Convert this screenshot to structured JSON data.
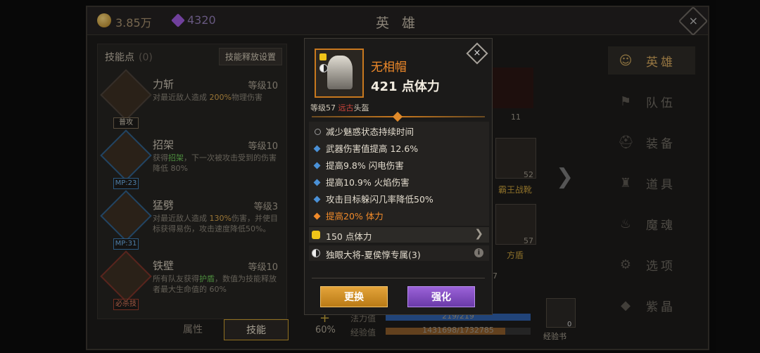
{
  "topbar": {
    "gold": "3.85万",
    "gems": "4320",
    "title": "英 雄",
    "close_label": "×"
  },
  "skills_panel": {
    "header": "技能点",
    "count": "(0)",
    "release_settings": "技能释放设置",
    "skills": [
      {
        "name": "力斩",
        "level": "等级10",
        "tag": "普攻",
        "desc_a": "对最近敌人造成 ",
        "desc_hl": "200%",
        "desc_b": "物理伤害"
      },
      {
        "name": "招架",
        "level": "等级10",
        "tag": "MP:23",
        "desc_a": "获得",
        "desc_hl": "招架",
        "desc_b": "，下一次被攻击受到的伤害降低 80%"
      },
      {
        "name": "猛劈",
        "level": "等级3",
        "tag": "MP:31",
        "desc_a": "对最近敌人造成 ",
        "desc_hl": "130%",
        "desc_b": "伤害，并使目标获得易伤，攻击速度降低50%。"
      },
      {
        "name": "铁壁",
        "level": "等级10",
        "tag": "必杀技",
        "desc_a": "所有队友获得",
        "desc_hl": "护盾",
        "desc_b": "，数值为技能释放者最大生命值的 60%"
      }
    ],
    "tabs": [
      "属性",
      "技能"
    ]
  },
  "hero_stats": {
    "plus": "+",
    "percent": "60%",
    "mana_label": "法力值",
    "mana_value": "219/219",
    "mana_fraction": 1.0,
    "exp_label": "经验值",
    "exp_value": "1431698/1732785",
    "exp_fraction": 0.826,
    "exp_book_label": "经验书",
    "exp_book_count": "0"
  },
  "equipment_peek": {
    "hero_level": "11",
    "boots_label": "霸王战靴",
    "boots_level": "52",
    "shield_label": "方盾",
    "shield_level": "57",
    "partial_num": "7",
    "next_arrow": "❯"
  },
  "right_nav": {
    "items": [
      {
        "label": "英雄",
        "icon": "hero-icon",
        "glyph": "☺"
      },
      {
        "label": "队伍",
        "icon": "flag-icon",
        "glyph": "⚑"
      },
      {
        "label": "装备",
        "icon": "helmet-icon",
        "glyph": "⛑"
      },
      {
        "label": "道具",
        "icon": "bag-icon",
        "glyph": "♜"
      },
      {
        "label": "魔魂",
        "icon": "flame-icon",
        "glyph": "♨"
      },
      {
        "label": "选项",
        "icon": "gear-icon",
        "glyph": "⚙"
      },
      {
        "label": "紫晶",
        "icon": "crystal-icon",
        "glyph": "◆"
      }
    ]
  },
  "popup": {
    "name": "无相帽",
    "main_stat": "421 点体力",
    "meta_level": "等级57 ",
    "meta_type": "远古",
    "meta_slot": "头盔",
    "attributes": [
      {
        "text": "减少魅惑状态持续时间",
        "style": "ring"
      },
      {
        "text": "武器伤害值提高 12.6%",
        "style": "blue"
      },
      {
        "text": "提高9.8% 闪电伤害",
        "style": "blue"
      },
      {
        "text": "提高10.9% 火焰伤害",
        "style": "blue"
      },
      {
        "text": "攻击目标躲闪几率降低50%",
        "style": "blue"
      },
      {
        "text": "提高20% 体力",
        "style": "orange"
      }
    ],
    "socket_row": "150 点体力",
    "socket_chevron": "❯",
    "set_row": "独眼大将-夏侯惇专属(3)",
    "info_icon": "i",
    "close_label": "×",
    "btn_swap": "更换",
    "btn_enhance": "强化",
    "colors": {
      "rarity": "#f08a2a",
      "swap": "#d99426",
      "enhance": "#8750c6"
    }
  }
}
